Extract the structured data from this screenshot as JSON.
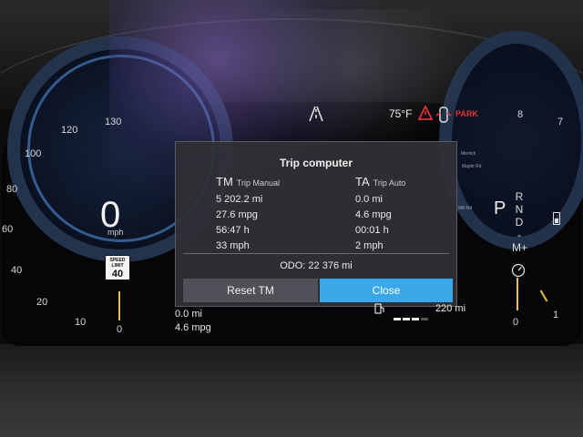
{
  "speedometer": {
    "ticks": [
      "130",
      "120",
      "100",
      "80",
      "60",
      "40",
      "20",
      "10",
      "0"
    ],
    "speed": "0",
    "unit": "mph",
    "speed_limit_label": "SPEED LIMIT",
    "speed_limit_value": "40"
  },
  "status_bar": {
    "temperature": "75°F",
    "park_label": "PARK"
  },
  "trip_computer": {
    "title": "Trip computer",
    "manual": {
      "code": "TM",
      "name": "Trip Manual",
      "distance": "5 202.2 mi",
      "economy": "27.6 mpg",
      "time": "56:47 h",
      "avg_speed": "33 mph"
    },
    "auto": {
      "code": "TA",
      "name": "Trip Auto",
      "distance": "0.0 mi",
      "economy": "4.6 mpg",
      "time": "00:01 h",
      "avg_speed": "2 mph"
    },
    "odometer": "ODO: 22 376 mi",
    "reset_label": "Reset TM",
    "close_label": "Close"
  },
  "tachometer": {
    "ticks": [
      "8",
      "7",
      "1",
      "0"
    ],
    "gear_selected": "P",
    "gear_list": [
      "R",
      "N",
      "D",
      "-M+"
    ]
  },
  "bottom_info": {
    "trip_distance": "0.0 mi",
    "trip_economy": "4.6 mpg",
    "range": "220 mi"
  },
  "map_labels": [
    "Merrick",
    "Maple Rd",
    "Mill Rd"
  ],
  "colors": {
    "close_button": "#3aa8e8",
    "park_warning": "#e03434",
    "gauge_ring": "#23334c"
  }
}
